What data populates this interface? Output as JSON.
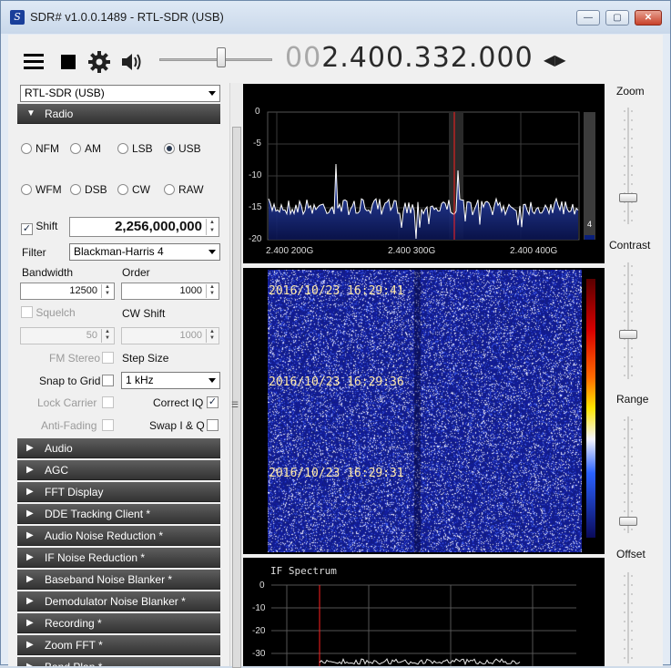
{
  "window": {
    "title": "SDR# v1.0.0.1489 - RTL-SDR (USB)",
    "app_icon": "sdr-icon",
    "controls": {
      "minimize": "—",
      "maximize": "▢",
      "close": "✕"
    }
  },
  "toolbar": {
    "menu_icon": "hamburger-icon",
    "stop_icon": "stop-icon",
    "settings_icon": "gear-icon",
    "audio_icon": "speaker-icon",
    "volume_level": 0.55,
    "frequency_prefix": "00",
    "frequency_main": "2.400.332.000",
    "tune_arrows": "◀▶"
  },
  "left_panel": {
    "device": "RTL-SDR (USB)",
    "radio_header": "Radio",
    "modes": [
      {
        "label": "NFM",
        "selected": false
      },
      {
        "label": "AM",
        "selected": false
      },
      {
        "label": "LSB",
        "selected": false
      },
      {
        "label": "USB",
        "selected": true
      },
      {
        "label": "WFM",
        "selected": false
      },
      {
        "label": "DSB",
        "selected": false
      },
      {
        "label": "CW",
        "selected": false
      },
      {
        "label": "RAW",
        "selected": false
      }
    ],
    "shift_label": "Shift",
    "shift_value": "2,256,000,000",
    "filter_label": "Filter",
    "filter_value": "Blackman-Harris 4",
    "bandwidth_label": "Bandwidth",
    "bandwidth_value": "12500",
    "order_label": "Order",
    "order_value": "1000",
    "squelch_label": "Squelch",
    "squelch_value": "50",
    "cw_shift_label": "CW Shift",
    "cw_shift_value": "1000",
    "fm_stereo_label": "FM Stereo",
    "step_size_label": "Step Size",
    "snap_label": "Snap to Grid",
    "step_value": "1 kHz",
    "lock_carrier_label": "Lock Carrier",
    "correct_iq_label": "Correct IQ",
    "anti_fading_label": "Anti-Fading",
    "swap_iq_label": "Swap I & Q",
    "check_mark": "✓",
    "sections": [
      "Audio",
      "AGC",
      "FFT Display",
      "DDE Tracking Client *",
      "Audio Noise Reduction *",
      "IF Noise Reduction *",
      "Baseband Noise Blanker *",
      "Demodulator Noise Blanker *",
      "Recording *",
      "Zoom FFT *",
      "Band Plan *"
    ]
  },
  "spectrum": {
    "y_ticks": [
      "0",
      "-5",
      "-10",
      "-15",
      "-20"
    ],
    "x_ticks": [
      "2.400 200G",
      "2.400 300G",
      "2.400 400G"
    ],
    "meter_value": "4"
  },
  "waterfall": {
    "timestamps": [
      "2016/10/23 16:29:41",
      "2016/10/23 16:29:36",
      "2016/10/23 16:29:31"
    ]
  },
  "if_spectrum": {
    "title": "IF Spectrum",
    "y_ticks": [
      "0",
      "-10",
      "-20",
      "-30"
    ]
  },
  "side_controls": {
    "zoom_label": "Zoom",
    "contrast_label": "Contrast",
    "range_label": "Range",
    "offset_label": "Offset"
  },
  "colors": {
    "header_bg": "#444444",
    "spectrum_bg": "#000000",
    "waterfall_blue": "#1c2d9a",
    "marker_red": "#ff2020"
  }
}
